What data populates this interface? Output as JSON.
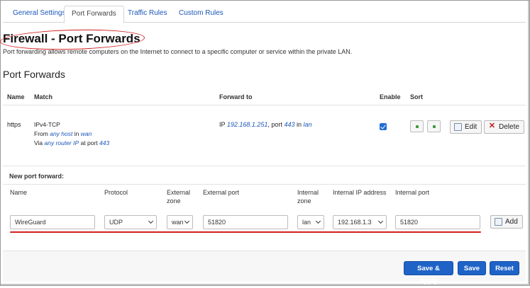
{
  "tabs": [
    {
      "label": "General Settings"
    },
    {
      "label": "Port Forwards"
    },
    {
      "label": "Traffic Rules"
    },
    {
      "label": "Custom Rules"
    }
  ],
  "page": {
    "title": "Firewall - Port Forwards",
    "description": "Port forwarding allows remote computers on the Internet to connect to a specific computer or service within the private LAN.",
    "section_title": "Port Forwards"
  },
  "table": {
    "headers": {
      "name": "Name",
      "match": "Match",
      "forward_to": "Forward to",
      "enable": "Enable",
      "sort": "Sort"
    },
    "rows": [
      {
        "name": "https",
        "proto": "IPv4-TCP",
        "from_prefix": "From",
        "from_host": "any host",
        "from_in": "in",
        "from_zone": "wan",
        "via_prefix": "Via",
        "via_ip": "any router IP",
        "via_at": "at port",
        "via_port": "443",
        "fwd_ip_prefix": "IP",
        "fwd_ip": "192.168.1.251",
        "fwd_port_prefix": ", port",
        "fwd_port": "443",
        "fwd_in": "in",
        "fwd_zone": "lan",
        "enabled": true,
        "edit_label": "Edit",
        "delete_label": "Delete"
      }
    ]
  },
  "new_forward": {
    "heading": "New port forward:",
    "labels": {
      "name": "Name",
      "protocol": "Protocol",
      "ext_zone_1": "External",
      "ext_zone_2": "zone",
      "ext_port": "External port",
      "int_zone_1": "Internal",
      "int_zone_2": "zone",
      "int_ip": "Internal IP address",
      "int_port": "Internal port"
    },
    "values": {
      "name": "WireGuard",
      "protocol": "UDP",
      "ext_zone": "wan",
      "ext_port": "51820",
      "int_zone": "lan",
      "int_ip": "192.168.1.3",
      "int_port": "51820"
    },
    "add_label": "Add"
  },
  "footer": {
    "save_apply": "Save & Apply",
    "save": "Save",
    "reset": "Reset"
  },
  "colors": {
    "link": "#1a56b8",
    "primary": "#1f63c7",
    "annotation": "#d21f1f"
  }
}
